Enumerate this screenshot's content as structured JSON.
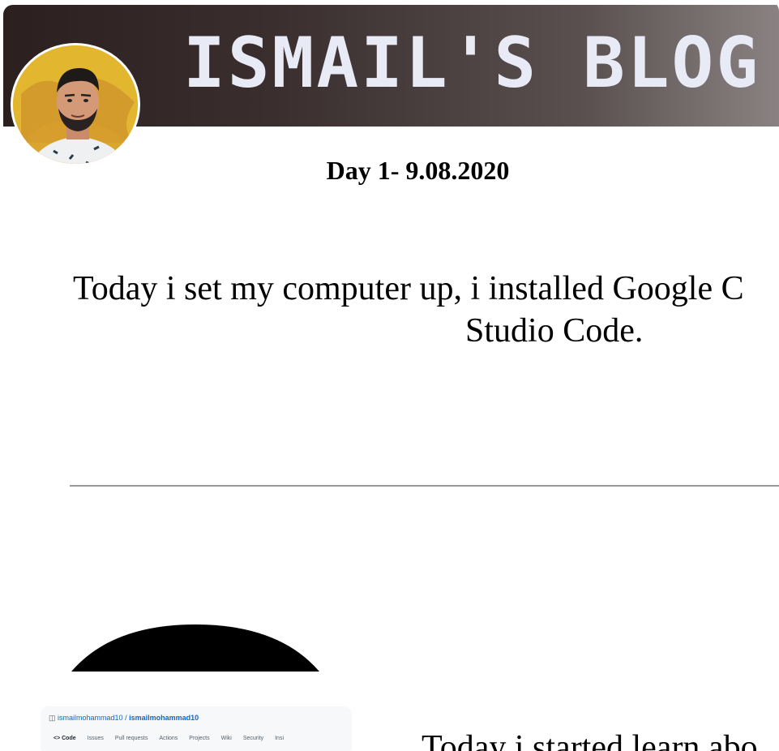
{
  "header": {
    "title": "ISMAIL'S BLOG"
  },
  "colors": {
    "header_dark": "#2c1f1f",
    "title_text": "#e8eaf5",
    "avatar_bg": "#e2b62f",
    "github_link": "#0969da"
  },
  "posts": [
    {
      "title": "Day 1- 9.08.2020",
      "body_line1": "Today i set my computer up, i installed Google C",
      "body_line2": "Studio Code."
    },
    {
      "body_line1": "Today i started learn abo"
    }
  ],
  "github_card": {
    "owner": "ismailmohammad10",
    "separator": " / ",
    "repo": "ismailmohammad10",
    "tabs": [
      "<> Code",
      "Issues",
      "Pull requests",
      "Actions",
      "Projects",
      "Wiki",
      "Security",
      "Insi"
    ]
  }
}
